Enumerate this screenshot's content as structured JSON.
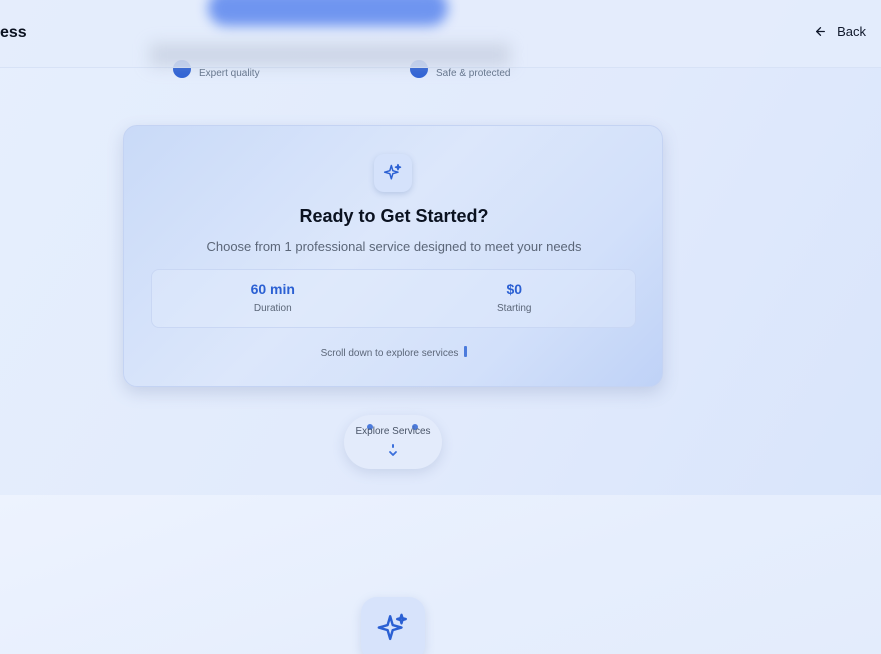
{
  "header": {
    "title": "ess",
    "back_label": "Back"
  },
  "features": [
    {
      "label": "Expert quality"
    },
    {
      "label": "Safe & protected"
    }
  ],
  "card": {
    "title": "Ready to Get Started?",
    "subtitle": "Choose from 1 professional service designed to meet your needs",
    "stats": [
      {
        "value": "60 min",
        "label": "Duration"
      },
      {
        "value": "$0",
        "label": "Starting"
      }
    ],
    "scroll_hint": "Scroll down to explore services"
  },
  "explore": {
    "label": "Explore Services"
  },
  "icons": {
    "card": "sparkles-icon",
    "back": "arrow-left-icon",
    "explore": "arrow-down-icon",
    "bottom": "sparkles-icon"
  },
  "colors": {
    "accent": "#2b60d3",
    "title": "#0b1220",
    "muted": "#5b6678"
  }
}
